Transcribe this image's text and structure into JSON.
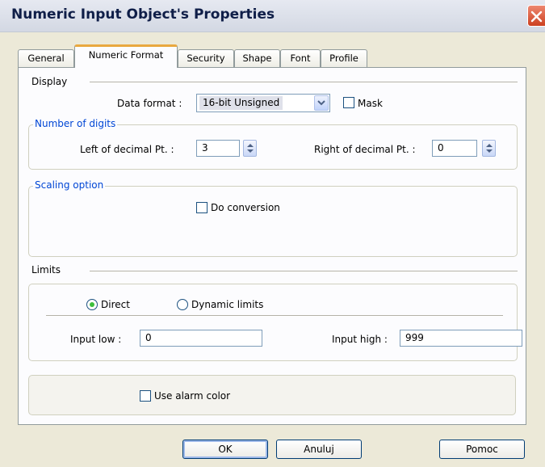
{
  "window": {
    "title": "Numeric Input Object's Properties"
  },
  "tabs": [
    {
      "label": "General",
      "active": false
    },
    {
      "label": "Numeric Format",
      "active": true
    },
    {
      "label": "Security",
      "active": false
    },
    {
      "label": "Shape",
      "active": false
    },
    {
      "label": "Font",
      "active": false
    },
    {
      "label": "Profile",
      "active": false
    }
  ],
  "display": {
    "section_label": "Display",
    "data_format_label": "Data format :",
    "data_format_value": "16-bit Unsigned",
    "mask_label": "Mask",
    "mask_checked": false
  },
  "digits": {
    "group_label": "Number of digits",
    "left_label": "Left of decimal Pt. :",
    "left_value": "3",
    "right_label": "Right of decimal Pt. :",
    "right_value": "0"
  },
  "scaling": {
    "group_label": "Scaling option",
    "do_conversion_label": "Do conversion",
    "do_conversion_checked": false
  },
  "limits": {
    "section_label": "Limits",
    "direct_label": "Direct",
    "dynamic_label": "Dynamic limits",
    "selected": "Direct",
    "input_low_label": "Input low :",
    "input_low_value": "0",
    "input_high_label": "Input high :",
    "input_high_value": "999"
  },
  "alarm": {
    "use_alarm_color_label": "Use alarm color",
    "checked": false
  },
  "buttons": {
    "ok": "OK",
    "cancel": "Anuluj",
    "help": "Pomoc"
  },
  "colors": {
    "dialog_bg": "#ece9d8",
    "group_title": "#0046d5",
    "active_tab_accent": "#e9a83f",
    "close_button": "#d9552f"
  },
  "icons": {
    "close": "close-icon",
    "dropdown": "chevron-down-icon",
    "spinner": "spinner-arrows-icon"
  }
}
